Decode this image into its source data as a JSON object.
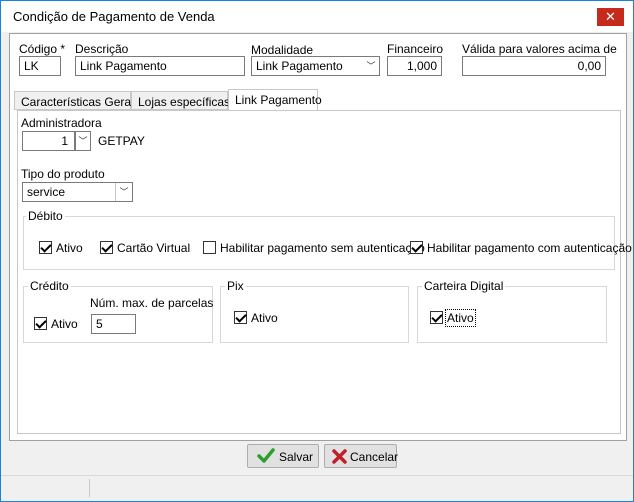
{
  "window": {
    "title": "Condição de Pagamento de Venda",
    "close_glyph": "✕"
  },
  "header": {
    "codigo_label": "Código *",
    "codigo_value": "LK",
    "descricao_label": "Descrição",
    "descricao_value": "Link Pagamento",
    "modalidade_label": "Modalidade",
    "modalidade_value": "Link Pagamento",
    "financeiro_label": "Financeiro",
    "financeiro_value": "1,000",
    "valida_label": "Válida para valores acima de",
    "valida_value": "0,00"
  },
  "tabs": [
    {
      "label": "Características Gerais",
      "active": false
    },
    {
      "label": "Lojas específicas",
      "active": false
    },
    {
      "label": "Link Pagamento",
      "active": true
    }
  ],
  "link_pagamento": {
    "administradora_label": "Administradora",
    "administradora_value": "1",
    "administradora_name": "GETPAY",
    "tipo_produto_label": "Tipo do produto",
    "tipo_produto_value": "service",
    "debito": {
      "legend": "Débito",
      "ativo_label": "Ativo",
      "ativo_checked": true,
      "cartao_virtual_label": "Cartão Virtual",
      "cartao_virtual_checked": true,
      "sem_auth_label": "Habilitar pagamento sem autenticação",
      "sem_auth_checked": false,
      "com_auth_label": "Habilitar pagamento com autenticação",
      "com_auth_checked": true
    },
    "credito": {
      "legend": "Crédito",
      "ativo_label": "Ativo",
      "ativo_checked": true,
      "parcelas_label": "Núm. max. de parcelas",
      "parcelas_value": "5"
    },
    "pix": {
      "legend": "Pix",
      "ativo_label": "Ativo",
      "ativo_checked": true
    },
    "carteira": {
      "legend": "Carteira Digital",
      "ativo_label": "Ativo",
      "ativo_checked": true
    }
  },
  "footer": {
    "salvar_label": "Salvar",
    "cancelar_label": "Cancelar",
    "colors": {
      "salvar_icon": "#2e9e2e",
      "cancelar_icon": "#c0202a"
    }
  }
}
